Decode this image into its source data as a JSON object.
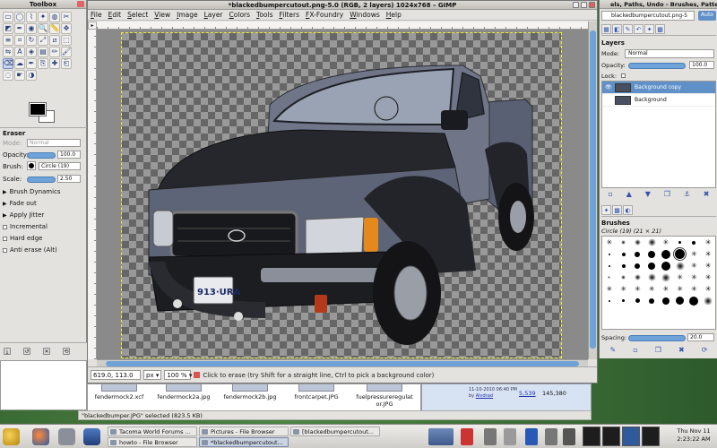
{
  "toolbox": {
    "title": "Toolbox",
    "tool_icons": [
      "rect-select",
      "ellipse-select",
      "free-select",
      "fuzzy-select",
      "color-select",
      "scissors",
      "foreground-select",
      "paths",
      "color-picker",
      "zoom",
      "measure",
      "move",
      "align",
      "crop",
      "rotate",
      "scale",
      "shear",
      "perspective",
      "flip",
      "text",
      "bucket-fill",
      "blend",
      "pencil",
      "paintbrush",
      "eraser",
      "airbrush",
      "ink",
      "clone",
      "heal",
      "perspective-clone",
      "blur",
      "smudge",
      "dodge-burn"
    ],
    "tool_options": {
      "title": "Eraser",
      "mode_label": "Mode:",
      "mode_value": "Normal",
      "opacity_label": "Opacity:",
      "opacity_value": "100.0",
      "brush_label": "Brush:",
      "brush_value": "Circle (19)",
      "scale_label": "Scale:",
      "scale_value": "2.50",
      "brush_dynamics": "Brush Dynamics",
      "fade_out": "Fade out",
      "apply_jitter": "Apply Jitter",
      "incremental": "Incremental",
      "hard_edge": "Hard edge",
      "anti_erase": "Anti erase  (Alt)"
    }
  },
  "image_window": {
    "title": "*blackedbumpercutout.png-5.0 (RGB, 2 layers) 1024x768 – GIMP",
    "menu": [
      "File",
      "Edit",
      "Select",
      "View",
      "Image",
      "Layer",
      "Colors",
      "Tools",
      "Filters",
      "FX-Foundry",
      "Windows",
      "Help"
    ],
    "status": {
      "coords": "619.0, 113.0",
      "unit": "px",
      "zoom": "100 %",
      "message": "Click to erase (try Shift for a straight line, Ctrl to pick a background color)"
    },
    "colors": {
      "accent": "#6fa3d8",
      "truck_body": "#6b7185"
    }
  },
  "dock": {
    "title": "els, Paths, Undo - Brushes, Patter",
    "image_select": "blackedbumpercutout.png-5",
    "auto_button": "Auto",
    "layers": {
      "title": "Layers",
      "mode_label": "Mode:",
      "mode_value": "Normal",
      "opacity_label": "Opacity:",
      "opacity_value": "100.0",
      "lock_label": "Lock:",
      "items": [
        {
          "name": "Background copy",
          "selected": true
        },
        {
          "name": "Background",
          "selected": false
        }
      ]
    },
    "brushes": {
      "title": "Brushes",
      "current": "Circle (19) (21 × 21)",
      "spacing_label": "Spacing:",
      "spacing_value": "20.0"
    }
  },
  "file_browser": {
    "files": [
      "fendermock2.xcf",
      "fendermock2a.jpg",
      "fendermock2b.jpg",
      "frontcarpet.JPG",
      "fuelpressureregulat or.JPG"
    ],
    "status": "\"blackedbumper.JPG\" selected (823.5 KB)"
  },
  "webpage": {
    "date": "11-10-2010 06:40 PM",
    "by_prefix": "by",
    "author": "Alvdrad",
    "replies": "5,539",
    "views": "145,380"
  },
  "taskbar": {
    "tasks": [
      {
        "label": "Tacoma World Forums ...",
        "active": false
      },
      {
        "label": "Pictures - File Browser",
        "active": false
      },
      {
        "label": "[blackedbumpercutout...",
        "active": false
      },
      {
        "label": "howto - File Browser",
        "active": false
      },
      {
        "label": "*blackedbumpercutout...",
        "active": true
      }
    ],
    "clock": {
      "date": "Thu Nov 11",
      "time": "2:23:22 AM"
    }
  }
}
